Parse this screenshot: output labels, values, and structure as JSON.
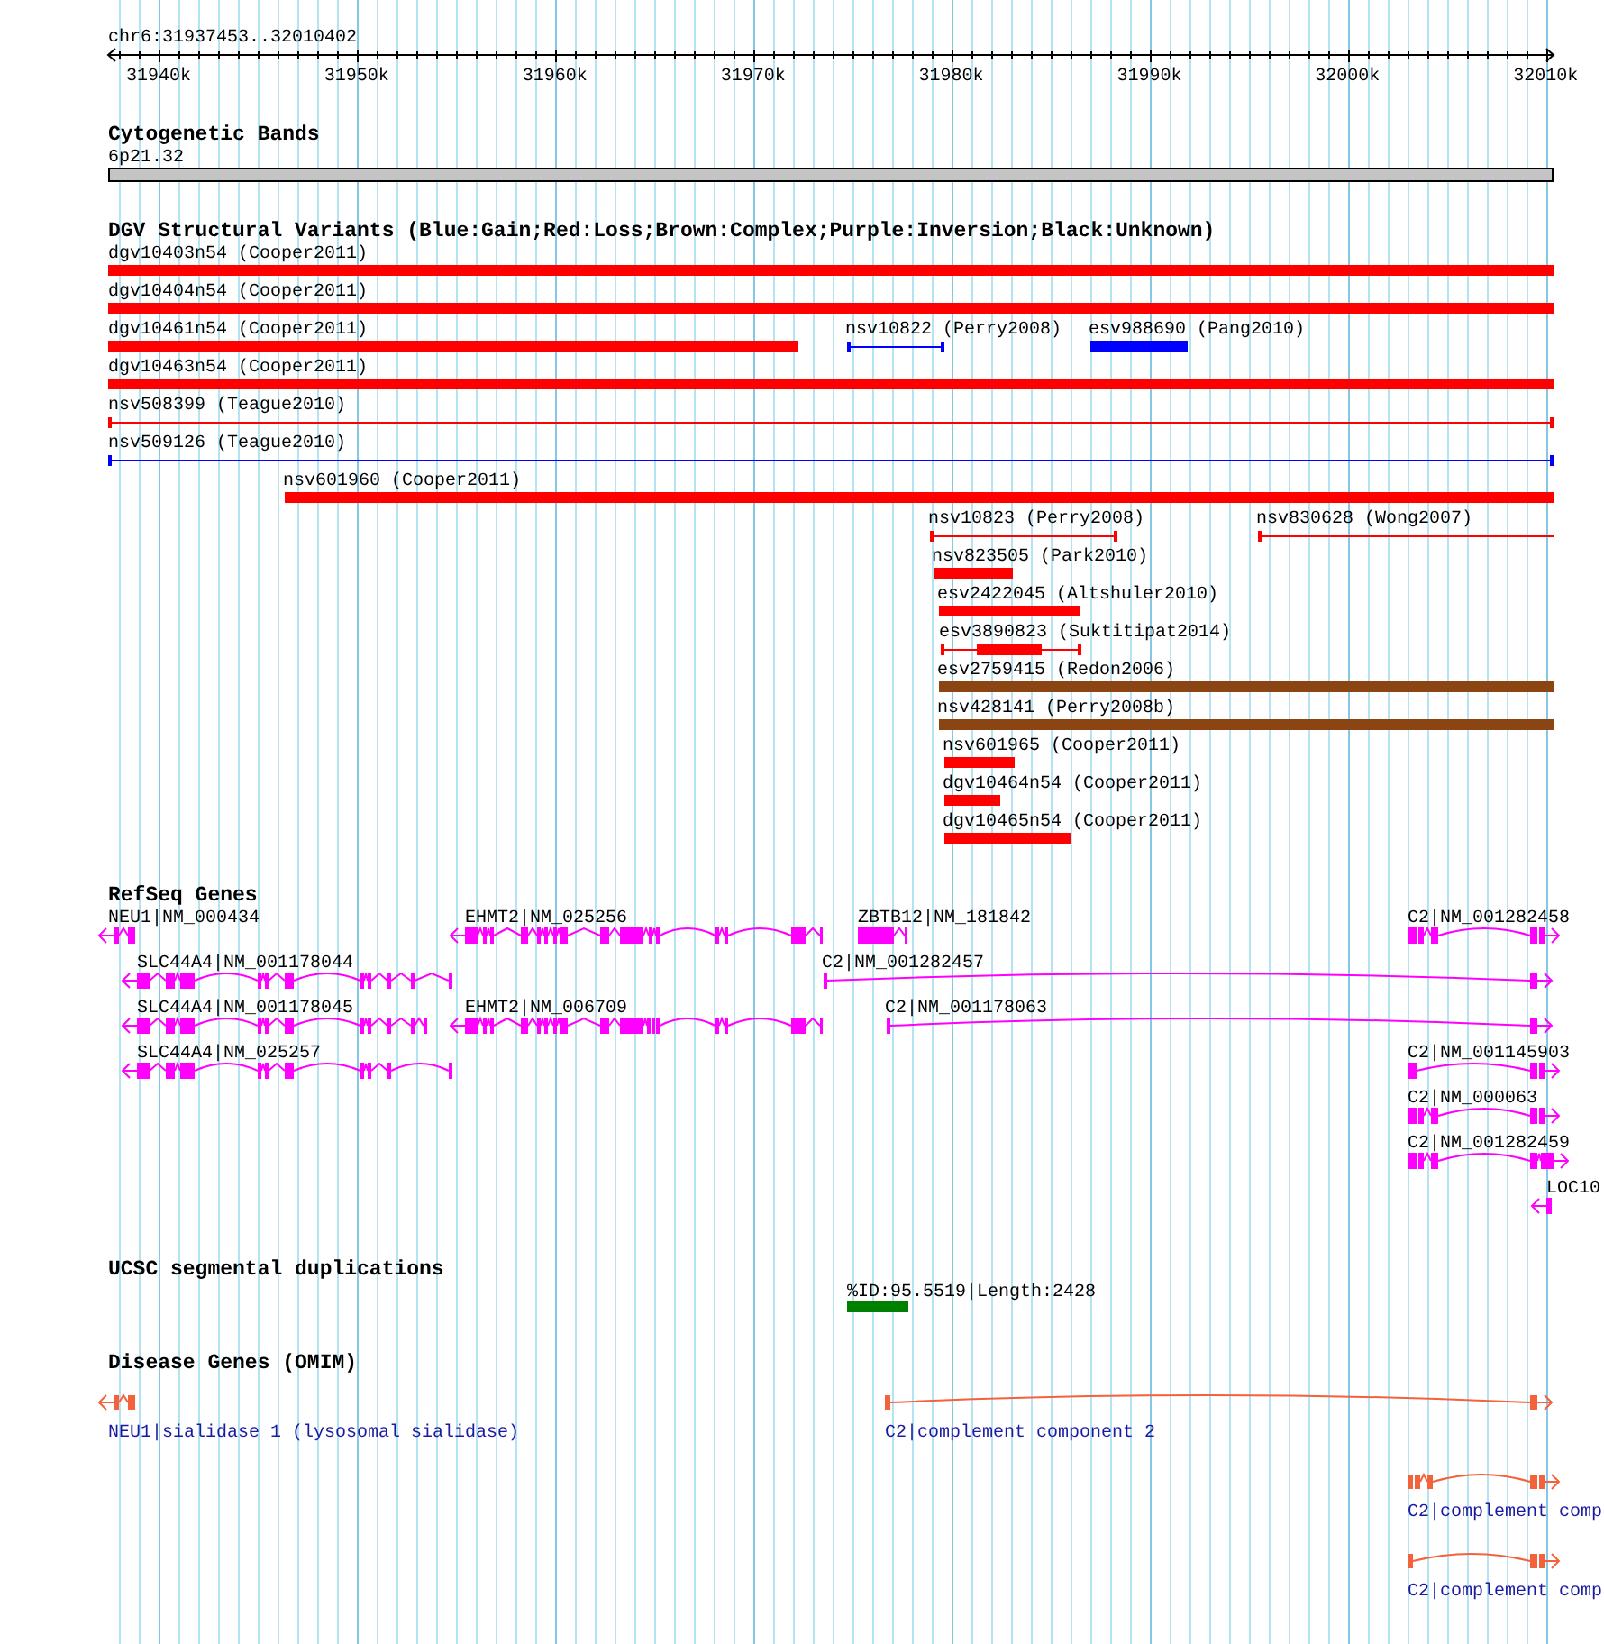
{
  "ruler": {
    "position": "chr6:31937453..32010402",
    "ticks": [
      "31940k",
      "31950k",
      "31960k",
      "31970k",
      "31980k",
      "31990k",
      "32000k",
      "32010k"
    ]
  },
  "tracks": [
    {
      "kind": "cytoband",
      "title": "Cytogenetic Bands",
      "features": [
        {
          "label": "6p21.32"
        }
      ]
    },
    {
      "kind": "variants",
      "title": "DGV Structural Variants (Blue:Gain;Red:Loss;Brown:Complex;Purple:Inversion;Black:Unknown)",
      "features": [
        {
          "label": "dgv10403n54 (Cooper2011)",
          "kind": "bar",
          "color": "#ff0000"
        },
        {
          "label": "dgv10404n54 (Cooper2011)",
          "kind": "bar",
          "color": "#ff0000"
        },
        {
          "label": "dgv10461n54 (Cooper2011)",
          "kind": "bar",
          "color": "#ff0000"
        },
        {
          "label": "nsv10822 (Perry2008)",
          "kind": "line",
          "color": "#0000ff"
        },
        {
          "label": "esv988690 (Pang2010)",
          "kind": "bar",
          "color": "#0000ff"
        },
        {
          "label": "dgv10463n54 (Cooper2011)",
          "kind": "bar",
          "color": "#ff0000"
        },
        {
          "label": "nsv508399 (Teague2010)",
          "kind": "line",
          "color": "#ff0000"
        },
        {
          "label": "nsv509126 (Teague2010)",
          "kind": "line",
          "color": "#0000ff"
        },
        {
          "label": "nsv601960 (Cooper2011)",
          "kind": "bar",
          "color": "#ff0000"
        },
        {
          "label": "nsv10823 (Perry2008)",
          "kind": "line",
          "color": "#ff0000"
        },
        {
          "label": "nsv830628 (Wong2007)",
          "kind": "line",
          "color": "#ff0000"
        },
        {
          "label": "nsv823505 (Park2010)",
          "kind": "bar",
          "color": "#ff0000"
        },
        {
          "label": "esv2422045 (Altshuler2010)",
          "kind": "bar",
          "color": "#ff0000"
        },
        {
          "label": "esv3890823 (Suktitipat2014)",
          "kind": "mixed",
          "color": "#ff0000"
        },
        {
          "label": "esv2759415 (Redon2006)",
          "kind": "bar",
          "color": "#8b4513"
        },
        {
          "label": "nsv428141 (Perry2008b)",
          "kind": "bar",
          "color": "#8b4513"
        },
        {
          "label": "nsv601965 (Cooper2011)",
          "kind": "bar",
          "color": "#ff0000"
        },
        {
          "label": "dgv10464n54 (Cooper2011)",
          "kind": "bar",
          "color": "#ff0000"
        },
        {
          "label": "dgv10465n54 (Cooper2011)",
          "kind": "bar",
          "color": "#ff0000"
        }
      ]
    },
    {
      "kind": "genes",
      "title": "RefSeq Genes",
      "features": [
        {
          "label": "NEU1|NM_000434",
          "kind": "reverse"
        },
        {
          "label": "EHMT2|NM_025256",
          "kind": "reverse"
        },
        {
          "label": "ZBTB12|NM_181842",
          "kind": "plain"
        },
        {
          "label": "C2|NM_001282458",
          "kind": "forward"
        },
        {
          "label": "SLC44A4|NM_001178044",
          "kind": "reverse"
        },
        {
          "label": "C2|NM_001282457",
          "kind": "forward"
        },
        {
          "label": "SLC44A4|NM_001178045",
          "kind": "reverse"
        },
        {
          "label": "EHMT2|NM_006709",
          "kind": "reverse"
        },
        {
          "label": "C2|NM_001178063",
          "kind": "forward"
        },
        {
          "label": "SLC44A4|NM_025257",
          "kind": "reverse"
        },
        {
          "label": "C2|NM_001145903",
          "kind": "forward"
        },
        {
          "label": "C2|NM_000063",
          "kind": "forward"
        },
        {
          "label": "C2|NM_001282459",
          "kind": "forward"
        },
        {
          "label": "LOC10",
          "kind": "reverse"
        }
      ]
    },
    {
      "kind": "segdup",
      "title": "UCSC segmental duplications",
      "features": [
        {
          "label": "%ID:95.5519|Length:2428"
        }
      ]
    },
    {
      "kind": "disease",
      "title": "Disease Genes (OMIM)",
      "features": [
        {
          "label": "NEU1|sialidase 1 (lysosomal sialidase)",
          "kind": "reverse"
        },
        {
          "label": "C2|complement component 2",
          "kind": "forward"
        },
        {
          "label": "C2|complement comp",
          "kind": "forward"
        },
        {
          "label": "C2|complement comp",
          "kind": "forward"
        }
      ]
    }
  ]
}
